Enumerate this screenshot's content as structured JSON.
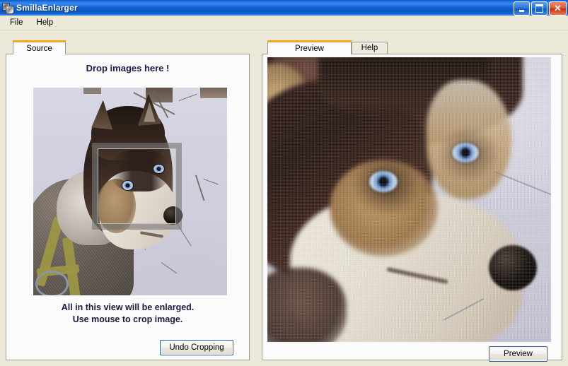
{
  "window": {
    "title": "SmillaEnlarger",
    "icon": "app-photos-icon",
    "controls": {
      "minimize": "minimize-button",
      "maximize": "maximize-button",
      "close": "close-button",
      "close_glyph": "✕"
    }
  },
  "menu": {
    "items": [
      {
        "label": "File"
      },
      {
        "label": "Help"
      }
    ]
  },
  "left_panel": {
    "tabs": [
      {
        "label": "Source",
        "active": true
      }
    ],
    "drop_label": "Drop images here !",
    "caption_line1": "All in this view will be enlarged.",
    "caption_line2": "Use mouse to crop image.",
    "undo_button": "Undo Cropping",
    "source_image_alt": "Siberian husky with blue eyes sitting in snow, wearing a harness, bare twigs around"
  },
  "right_panel": {
    "tabs": [
      {
        "label": "Preview",
        "active": true
      },
      {
        "label": "Help",
        "active": false
      }
    ],
    "preview_button": "Preview",
    "preview_image_alt": "Enlarged close-up of the husky's face with blue eyes and black nose"
  },
  "colors": {
    "titlebar_blue": "#1464D6",
    "active_tab_accent": "#F2A81C",
    "window_background": "#ECE9D8",
    "panel_background": "#FBFBFB",
    "panel_border": "#9C9C94",
    "button_border": "#2B5FA8",
    "drop_text": "#1A1A4E",
    "crop_overlay": "rgba(120,120,120,0.62)"
  }
}
